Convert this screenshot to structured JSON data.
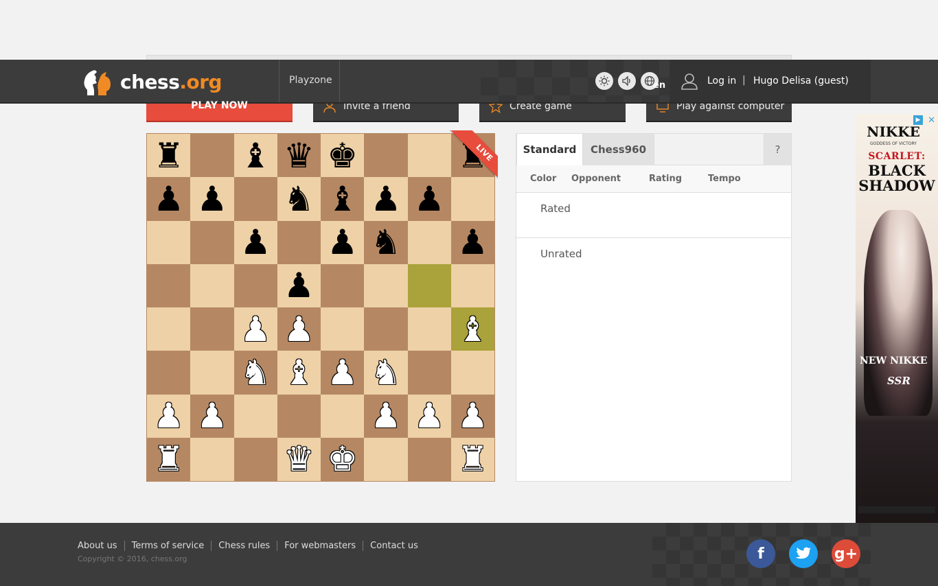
{
  "header": {
    "logo_text_main": "chess",
    "logo_text_org": ".org",
    "nav_playzone": "Playzone",
    "theme_icon": "sun-icon",
    "sound_icon": "speaker-icon",
    "lang_icon": "globe-icon",
    "lang_code": "en",
    "login_label": "Log in",
    "separator": "|",
    "guest_name": "Hugo Delisa (guest)"
  },
  "actions": {
    "play_now": "PLAY NOW",
    "invite_friend": "Invite a friend",
    "create_game": "Create game",
    "play_computer": "Play against computer"
  },
  "board": {
    "live_label": "LIVE",
    "rows": [
      [
        "br",
        "",
        "bb",
        "bq",
        "bk",
        "",
        "",
        "br"
      ],
      [
        "bp",
        "bp",
        "",
        "bn",
        "bb",
        "bp",
        "bp",
        ""
      ],
      [
        "",
        "",
        "bp",
        "",
        "bp",
        "bn",
        "",
        "bp"
      ],
      [
        "",
        "",
        "",
        "bp",
        "",
        "",
        "",
        ""
      ],
      [
        "",
        "",
        "wp",
        "wp",
        "",
        "",
        "",
        "wb"
      ],
      [
        "",
        "",
        "wn",
        "wb",
        "wp",
        "wn",
        "",
        ""
      ],
      [
        "wp",
        "wp",
        "",
        "",
        "",
        "wp",
        "wp",
        "wp"
      ],
      [
        "wr",
        "",
        "",
        "wq",
        "wk",
        "",
        "",
        "wr"
      ]
    ],
    "highlight": [
      [
        3,
        6
      ],
      [
        4,
        7
      ]
    ],
    "colors": {
      "light": "#eed1a7",
      "dark": "#b58863",
      "highlight": "#aaa23a"
    }
  },
  "panel": {
    "tab_standard": "Standard",
    "tab_chess960": "Chess960",
    "help": "?",
    "col_color": "Color",
    "col_opponent": "Opponent",
    "col_rating": "Rating",
    "col_tempo": "Tempo",
    "rated": "Rated",
    "unrated": "Unrated"
  },
  "ad": {
    "title": "NIKKE",
    "subtitle": "GODDESS OF VICTORY",
    "line1": "SCARLET:",
    "line2": "BLACK SHADOW",
    "line3": "NEW NIKKE",
    "line4": "SSR",
    "close": "✕",
    "adchoice": "▶"
  },
  "footer": {
    "links": [
      "About us",
      "Terms of service",
      "Chess rules",
      "For webmasters",
      "Contact us"
    ],
    "copyright": "Copyright © 2016, chess.org",
    "social": {
      "facebook": "f",
      "twitter": "t",
      "google": "g+"
    }
  }
}
